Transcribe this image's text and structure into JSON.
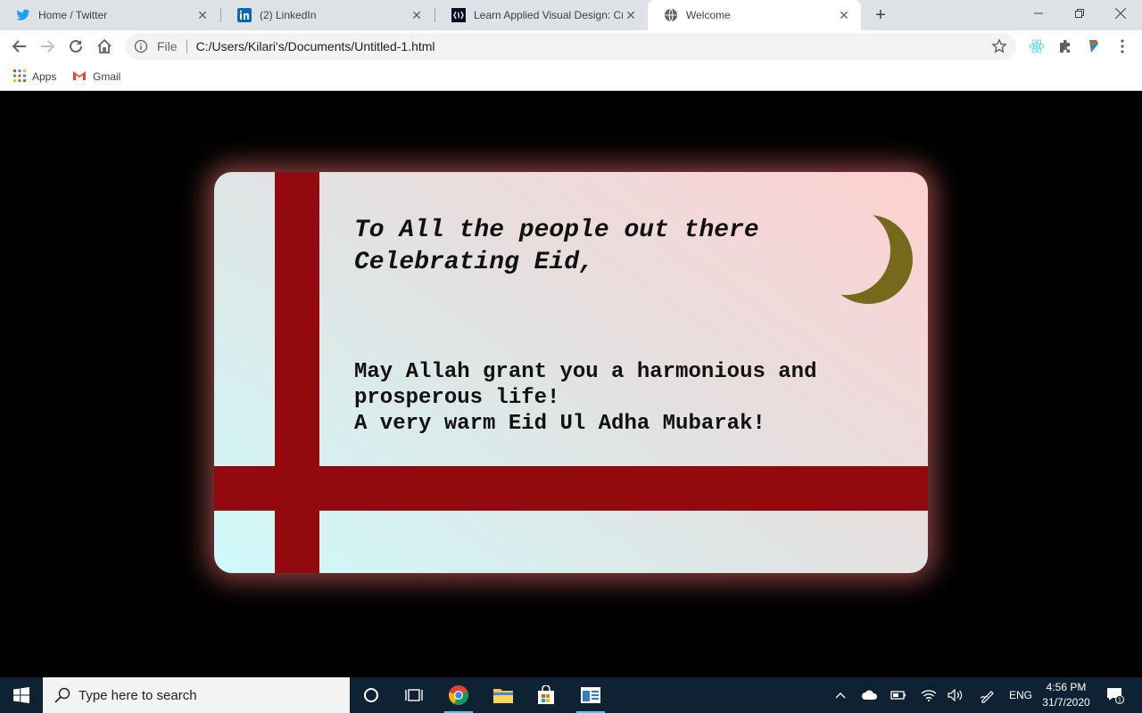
{
  "browser": {
    "tabs": [
      {
        "title": "Home / Twitter",
        "icon": "twitter-icon"
      },
      {
        "title": "(2) LinkedIn",
        "icon": "linkedin-icon"
      },
      {
        "title": "Learn Applied Visual Design: Cre",
        "icon": "freecodecamp-icon"
      },
      {
        "title": "Welcome",
        "icon": "globe-icon",
        "active": true
      }
    ],
    "close_glyph": "✕",
    "new_tab_glyph": "+",
    "omnibox": {
      "file_label": "File",
      "url": "C:/Users/Kilari's/Documents/Untitled-1.html"
    },
    "bookmarks": [
      {
        "label": "Apps",
        "icon": "apps-grid-icon"
      },
      {
        "label": "Gmail",
        "icon": "gmail-icon"
      }
    ]
  },
  "card": {
    "greeting_line1": "To All the people out there",
    "greeting_line2": "Celebrating Eid,",
    "message_line1": "May Allah grant you a harmonious and",
    "message_line2": "prosperous life!",
    "message_line3": "A very warm Eid Ul Adha Mubarak!",
    "colors": {
      "ribbon": "#920a0d",
      "moon": "#77691c",
      "gradient_start": "#cffafa",
      "gradient_end": "#ffd0d0",
      "glow": "#ff7878",
      "background": "#000000"
    }
  },
  "taskbar": {
    "search_placeholder": "Type here to search",
    "language": "ENG",
    "time": "4:56 PM",
    "date": "31/7/2020",
    "notification_count": "1"
  }
}
